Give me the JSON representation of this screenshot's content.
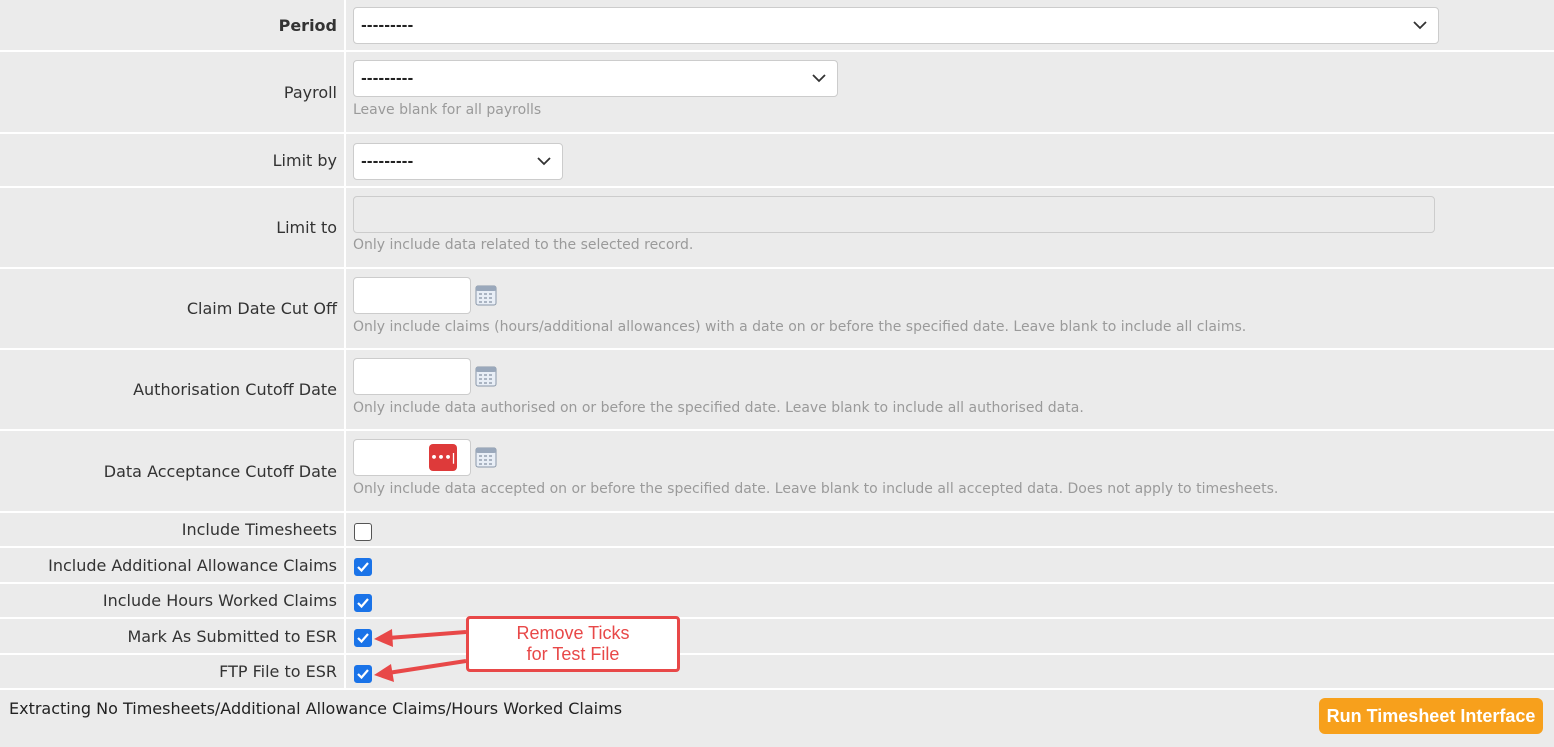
{
  "fields": {
    "period": {
      "label": "Period",
      "value": "---------"
    },
    "payroll": {
      "label": "Payroll",
      "value": "---------",
      "help": "Leave blank for all payrolls"
    },
    "limit_by": {
      "label": "Limit by",
      "value": "---------"
    },
    "limit_to": {
      "label": "Limit to",
      "value": "",
      "help": "Only include data related to the selected record."
    },
    "claim_date_cut_off": {
      "label": "Claim Date Cut Off",
      "value": "",
      "help": "Only include claims (hours/additional allowances) with a date on or before the specified date. Leave blank to include all claims."
    },
    "authorisation_cutoff_date": {
      "label": "Authorisation Cutoff Date",
      "value": "",
      "help": "Only include data authorised on or before the specified date. Leave blank to include all authorised data."
    },
    "data_acceptance_cutoff_date": {
      "label": "Data Acceptance Cutoff Date",
      "value": "",
      "help": "Only include data accepted on or before the specified date. Leave blank to include all accepted data. Does not apply to timesheets.",
      "password_manager_badge": "•••|"
    }
  },
  "checkboxes": [
    {
      "label": "Include Timesheets",
      "checked": false
    },
    {
      "label": "Include Additional Allowance Claims",
      "checked": true
    },
    {
      "label": "Include Hours Worked Claims",
      "checked": true
    },
    {
      "label": "Mark As Submitted to ESR",
      "checked": true
    },
    {
      "label": "FTP File to ESR",
      "checked": true
    }
  ],
  "footer": {
    "status_text": "Extracting No Timesheets/Additional Allowance Claims/Hours Worked Claims",
    "run_button_label": "Run Timesheet Interface"
  },
  "annotation": {
    "line1": "Remove Ticks",
    "line2": "for Test File"
  },
  "colors": {
    "row_background": "#ebebeb",
    "checkbox_checked": "#1a73e8",
    "run_button": "#f7a01c",
    "annotation_red": "#e84848",
    "password_badge": "#de3a3a"
  },
  "icons": {
    "select_arrow": "chevron-down-icon",
    "date_picker": "calendar-icon",
    "check": "checkmark-icon",
    "annotation_arrow": "arrow-left-icon"
  }
}
